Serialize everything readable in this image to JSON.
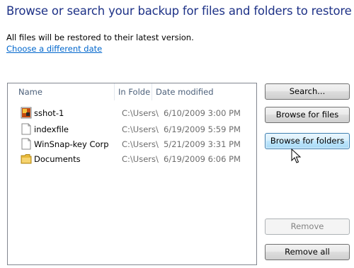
{
  "header": {
    "title": "Browse or search your backup for files and folders to restore",
    "info": "All files will be restored to their latest version.",
    "link": "Choose a different date"
  },
  "list": {
    "columns": [
      "Name",
      "In Folder",
      "Date modified"
    ],
    "rows": [
      {
        "name": "sshot-1",
        "folder": "C:\\Users\\",
        "date": "6/10/2009 3:00 PM",
        "icon": "image-file-icon"
      },
      {
        "name": "indexfile",
        "folder": "C:\\Users\\",
        "date": "6/19/2009 5:59 PM",
        "icon": "document-file-icon"
      },
      {
        "name": "WinSnap-key Corp",
        "folder": "C:\\Users\\",
        "date": "5/21/2009 3:31 PM",
        "icon": "document-file-icon"
      },
      {
        "name": "Documents",
        "folder": "C:\\Users\\",
        "date": "6/19/2009 6:06 PM",
        "icon": "folder-icon"
      }
    ]
  },
  "buttons": {
    "search": "Search...",
    "browse_files": "Browse for files",
    "browse_folders": "Browse for folders",
    "remove": "Remove",
    "remove_all": "Remove all"
  }
}
